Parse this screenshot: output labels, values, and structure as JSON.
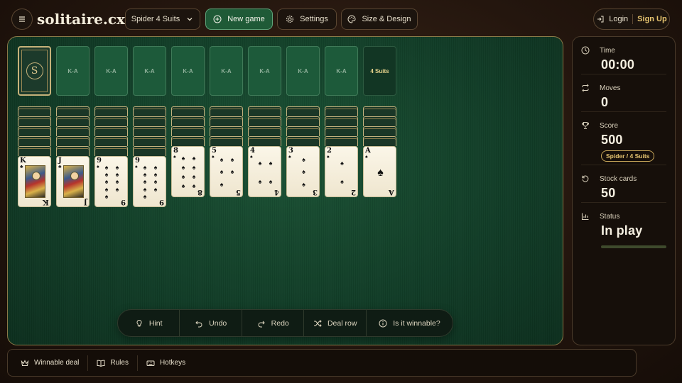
{
  "header": {
    "menu_icon": "hamburger-menu-icon",
    "logo": "solitaire.cx",
    "variant": "Spider 4 Suits",
    "new_game": "New game",
    "settings": "Settings",
    "design": "Size & Design",
    "login": "Login",
    "signup": "Sign Up",
    "accent_color": "#1f5a37",
    "gold_color": "#e6c470"
  },
  "board": {
    "stock_emblem": "S",
    "foundations": [
      "K-A",
      "K-A",
      "K-A",
      "K-A",
      "K-A",
      "K-A",
      "K-A",
      "K-A"
    ],
    "suits_label": "4 Suits",
    "tableau": [
      {
        "hidden": 5,
        "rank": "K",
        "suit": "♣"
      },
      {
        "hidden": 5,
        "rank": "J",
        "suit": "♣"
      },
      {
        "hidden": 5,
        "rank": "9",
        "suit": "♠"
      },
      {
        "hidden": 5,
        "rank": "9",
        "suit": "♠"
      },
      {
        "hidden": 4,
        "rank": "8",
        "suit": "♠"
      },
      {
        "hidden": 4,
        "rank": "5",
        "suit": "♠"
      },
      {
        "hidden": 4,
        "rank": "4",
        "suit": "♠"
      },
      {
        "hidden": 4,
        "rank": "3",
        "suit": "♠"
      },
      {
        "hidden": 4,
        "rank": "2",
        "suit": "♠"
      },
      {
        "hidden": 4,
        "rank": "A",
        "suit": "♠"
      }
    ]
  },
  "actions": {
    "hint": "Hint",
    "undo": "Undo",
    "redo": "Redo",
    "deal_row": "Deal row",
    "winnable": "Is it winnable?"
  },
  "stats": {
    "time_label": "Time",
    "time_value": "00:00",
    "moves_label": "Moves",
    "moves_value": "0",
    "score_label": "Score",
    "score_value": "500",
    "score_badge": "Spider / 4 Suits",
    "stock_label": "Stock cards",
    "stock_value": "50",
    "status_label": "Status",
    "status_value": "In play",
    "status_progress": 0
  },
  "footer": {
    "winnable_deal": "Winnable deal",
    "rules": "Rules",
    "hotkeys": "Hotkeys"
  }
}
